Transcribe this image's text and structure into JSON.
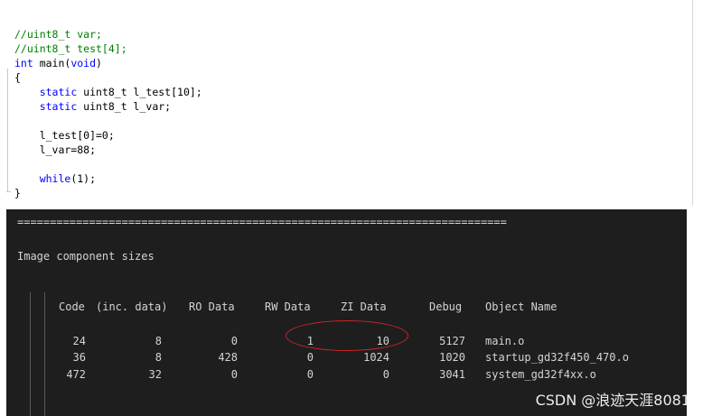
{
  "editor": {
    "lines": [
      {
        "parts": [
          {
            "text": "//uint8_t var;",
            "cls": "tok-comment"
          }
        ]
      },
      {
        "parts": [
          {
            "text": "//uint8_t test[4];",
            "cls": "tok-comment"
          }
        ]
      },
      {
        "parts": [
          {
            "text": "int",
            "cls": "tok-kw"
          },
          {
            "text": " main(",
            "cls": ""
          },
          {
            "text": "void",
            "cls": "tok-kw"
          },
          {
            "text": ")",
            "cls": ""
          }
        ]
      },
      {
        "parts": [
          {
            "text": "{",
            "cls": ""
          }
        ]
      },
      {
        "parts": [
          {
            "text": "    ",
            "cls": ""
          },
          {
            "text": "static",
            "cls": "tok-kw"
          },
          {
            "text": " uint8_t l_test[10];",
            "cls": ""
          }
        ]
      },
      {
        "parts": [
          {
            "text": "    ",
            "cls": ""
          },
          {
            "text": "static",
            "cls": "tok-kw"
          },
          {
            "text": " uint8_t l_var;",
            "cls": ""
          }
        ]
      },
      {
        "parts": [
          {
            "text": "",
            "cls": ""
          }
        ]
      },
      {
        "parts": [
          {
            "text": "    l_test[0]=0;",
            "cls": ""
          }
        ]
      },
      {
        "parts": [
          {
            "text": "    l_var=88;",
            "cls": ""
          }
        ]
      },
      {
        "parts": [
          {
            "text": "",
            "cls": ""
          }
        ]
      },
      {
        "parts": [
          {
            "text": "    ",
            "cls": ""
          },
          {
            "text": "while",
            "cls": "tok-kw"
          },
          {
            "text": "(1);",
            "cls": ""
          }
        ]
      },
      {
        "parts": [
          {
            "text": "}",
            "cls": ""
          }
        ]
      }
    ]
  },
  "output": {
    "separator": "===========================================================================",
    "heading": "Image component sizes",
    "columns": [
      "Code",
      "(inc. data)",
      "RO Data",
      "RW Data",
      "ZI Data",
      "Debug",
      "Object Name"
    ],
    "rows": [
      {
        "code": "24",
        "inc_data": "8",
        "ro_data": "0",
        "rw_data": "1",
        "zi_data": "10",
        "debug": "5127",
        "object_name": "main.o"
      },
      {
        "code": "36",
        "inc_data": "8",
        "ro_data": "428",
        "rw_data": "0",
        "zi_data": "1024",
        "debug": "1020",
        "object_name": "startup_gd32f450_470.o"
      },
      {
        "code": "472",
        "inc_data": "32",
        "ro_data": "0",
        "rw_data": "0",
        "zi_data": "0",
        "debug": "3041",
        "object_name": "system_gd32f4xx.o"
      }
    ],
    "highlight_color": "#d02424"
  },
  "watermark": "CSDN @浪迹天涯8081"
}
